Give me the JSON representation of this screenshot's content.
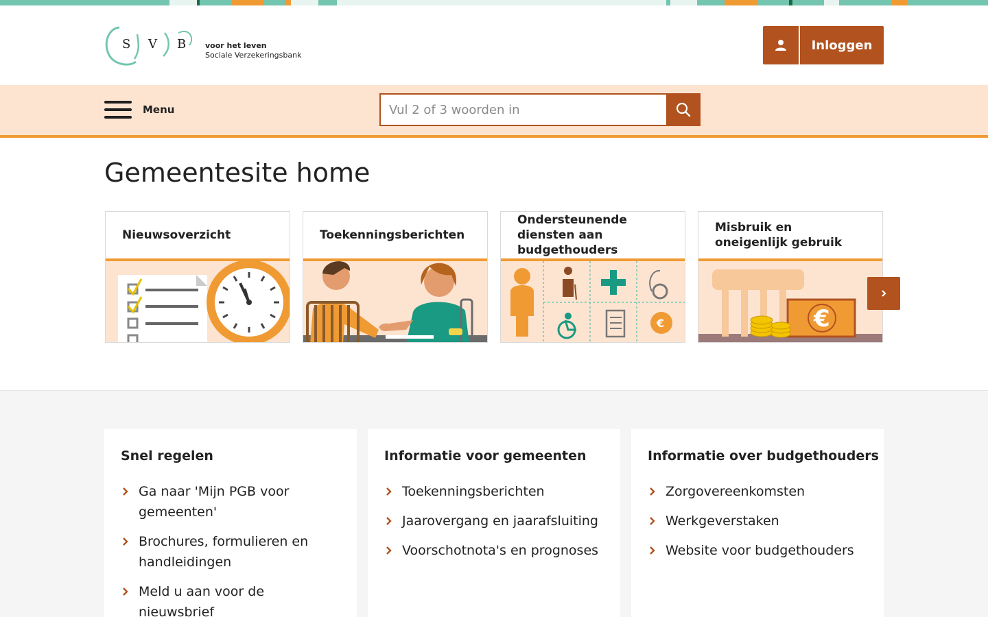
{
  "colors": {
    "accent": "#b1521f",
    "orange": "#f09a34",
    "peach": "#fde4d1",
    "teal": "#73c5b0"
  },
  "logo": {
    "letters": [
      "S",
      "V",
      "B"
    ],
    "tagline": "voor het leven",
    "org_name": "Sociale Verzekeringsbank"
  },
  "header": {
    "login_label": "Inloggen",
    "login_icon": "user-icon"
  },
  "nav": {
    "menu_label": "Menu",
    "search_placeholder": "Vul 2 of 3 woorden in",
    "search_icon": "search-icon"
  },
  "page": {
    "title": "Gemeentesite home"
  },
  "cards": [
    {
      "label": "Nieuwsoverzicht"
    },
    {
      "label": "Toekenningsberichten"
    },
    {
      "label": "Ondersteunende diensten aan budgethouders"
    },
    {
      "label": "Misbruik en oneigenlijk gebruik"
    }
  ],
  "carousel": {
    "next_icon": "chevron-right-icon"
  },
  "panels": [
    {
      "title": "Snel regelen",
      "links": [
        "Ga naar 'Mijn PGB voor gemeenten'",
        "Brochures, formulieren en handleidingen",
        "Meld u aan voor de nieuwsbrief"
      ]
    },
    {
      "title": "Informatie voor gemeenten",
      "links": [
        "Toekenningsberichten",
        "Jaarovergang en jaarafsluiting",
        "Voorschotnota's en prognoses"
      ]
    },
    {
      "title": "Informatie over budgethouders",
      "links": [
        "Zorgovereenkomsten",
        "Werkgeverstaken",
        "Website voor budgethouders"
      ]
    }
  ]
}
